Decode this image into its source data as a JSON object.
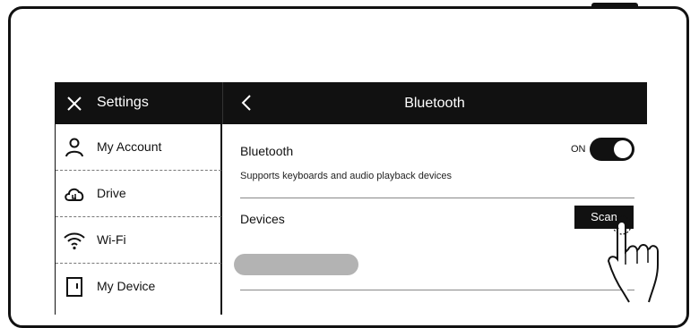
{
  "header": {
    "settings_title": "Settings",
    "page_title": "Bluetooth",
    "close_icon": "close-icon",
    "back_icon": "back-chevron-icon"
  },
  "sidebar": {
    "items": [
      {
        "label": "My Account",
        "icon": "user-icon"
      },
      {
        "label": "Drive",
        "icon": "cloud-icon"
      },
      {
        "label": "Wi-Fi",
        "icon": "wifi-icon"
      },
      {
        "label": "My Device",
        "icon": "device-icon"
      }
    ]
  },
  "bluetooth": {
    "label": "Bluetooth",
    "description": "Supports keyboards and audio playback devices",
    "toggle_state": "ON",
    "enabled": true
  },
  "devices": {
    "label": "Devices",
    "scan_label": "Scan"
  },
  "colors": {
    "bar": "#111111",
    "placeholder": "#b3b3b3",
    "background": "#ffffff"
  }
}
